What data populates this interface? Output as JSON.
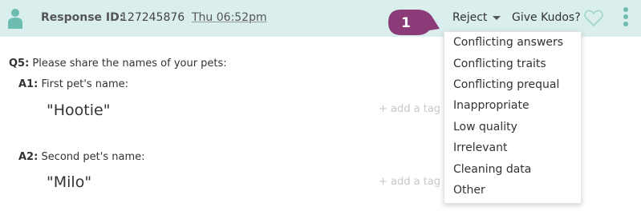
{
  "header": {
    "response_label": "Response ID:",
    "response_id": "127245876",
    "time": "Thu 06:52pm",
    "reject_label": "Reject",
    "kudos_label": "Give Kudos?"
  },
  "callout": {
    "number": "1"
  },
  "question": {
    "number": "Q5:",
    "text": " Please share the names of your pets:"
  },
  "answers": [
    {
      "label": "A1:",
      "text": " First pet's name:",
      "value": "\"Hootie\"",
      "add_tag": "+ add a tag"
    },
    {
      "label": "A2:",
      "text": " Second pet's name:",
      "value": "\"Milo\"",
      "add_tag": "+ add a tag"
    }
  ],
  "reject_menu": {
    "items": [
      "Conflicting answers",
      "Conflicting traits",
      "Conflicting prequal",
      "Inappropriate",
      "Low quality",
      "Irrelevant",
      "Cleaning data",
      "Other"
    ]
  },
  "colors": {
    "header_bg": "#d9eeed",
    "accent_teal": "#6dbcb0",
    "callout_purple": "#8a3b78"
  }
}
